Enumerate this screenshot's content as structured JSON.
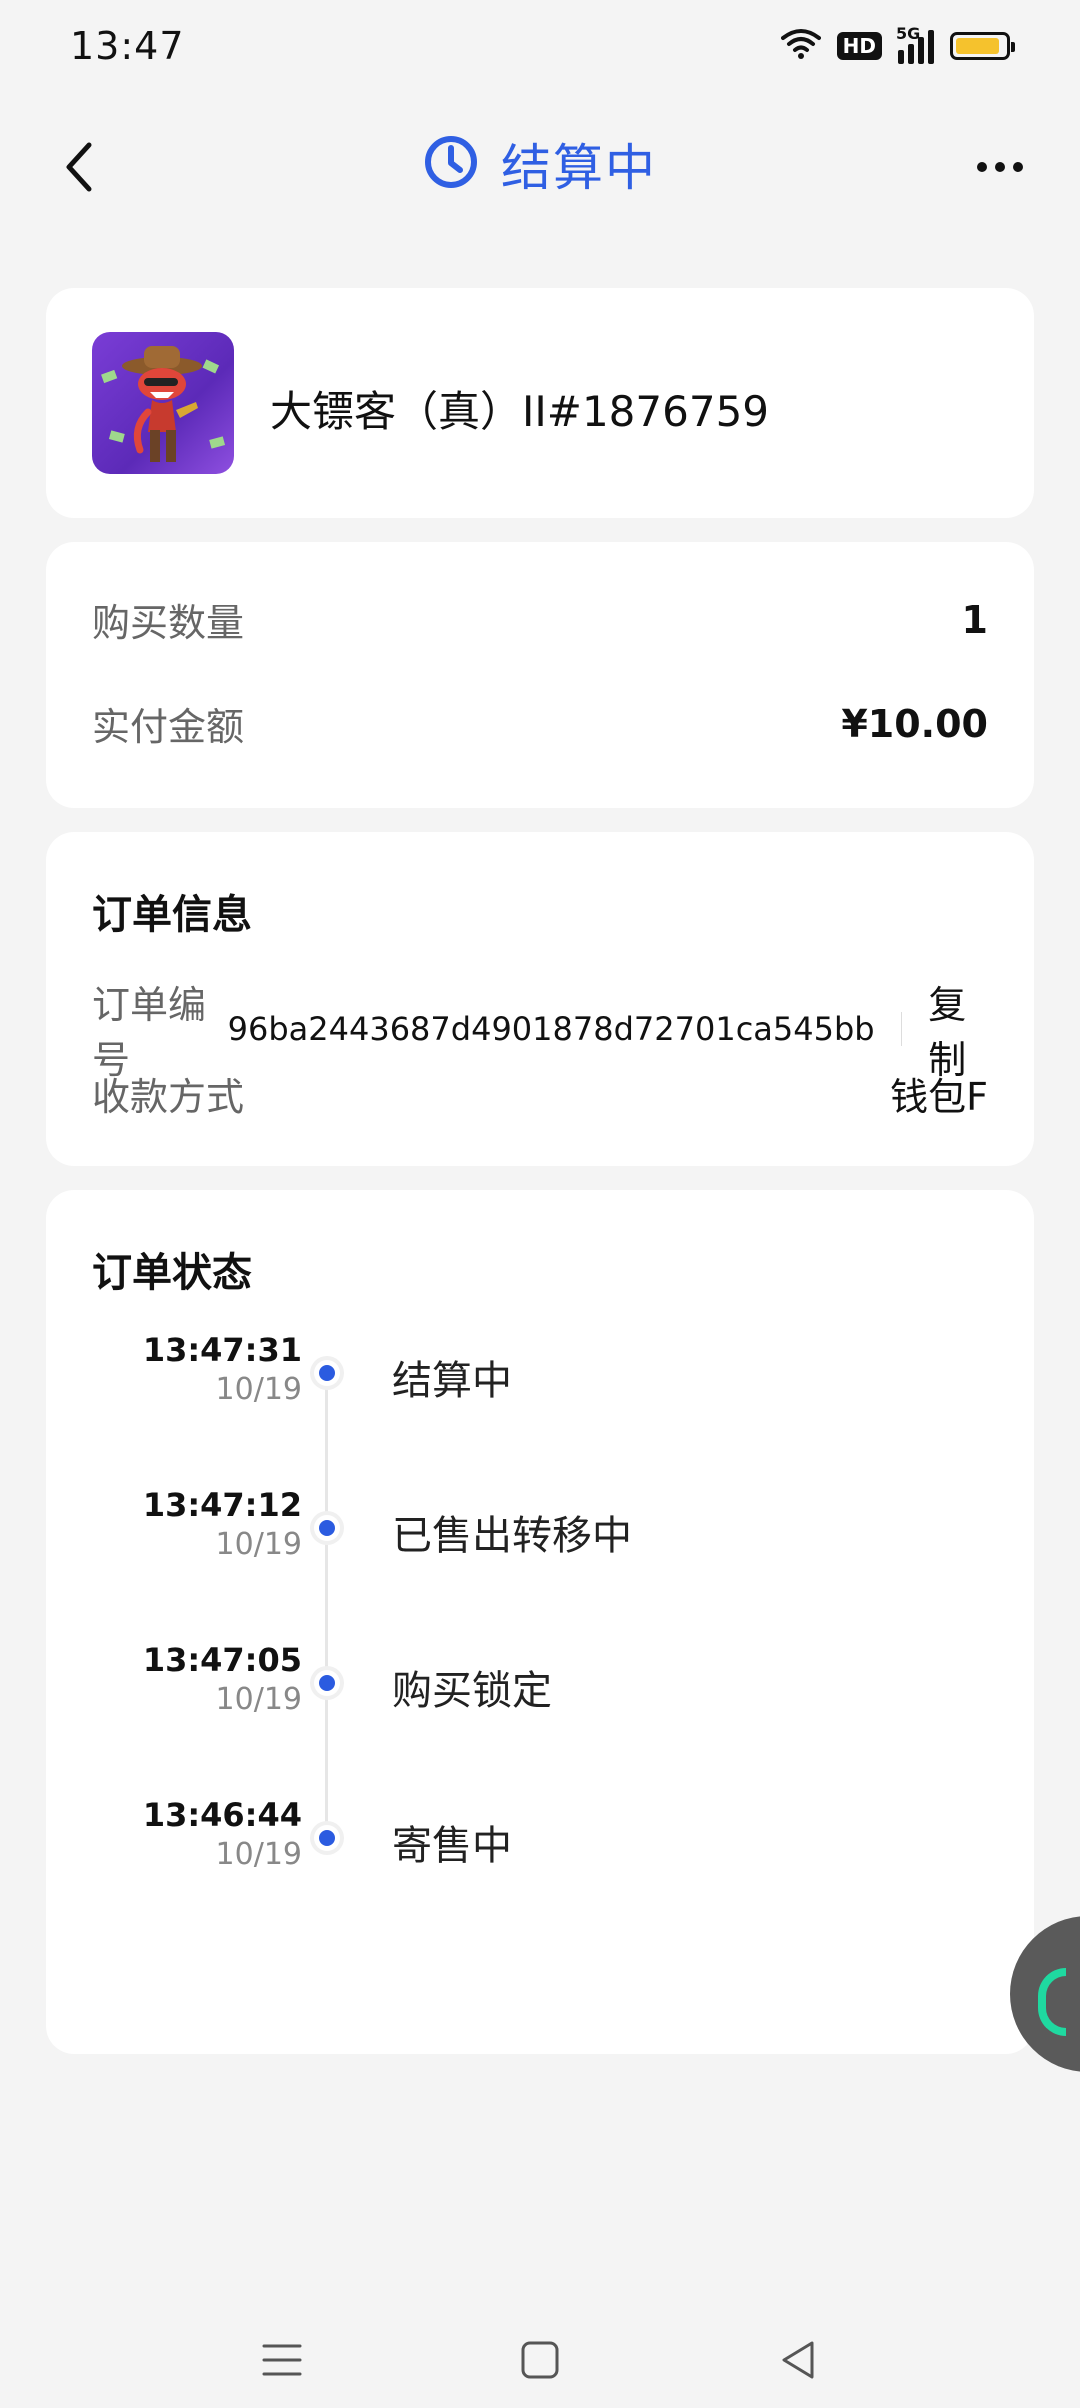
{
  "status_bar": {
    "time": "13:47",
    "hd_label": "HD",
    "network_label": "5G",
    "battery_level": 0.9,
    "battery_color": "#f5c22d"
  },
  "header": {
    "title": "结算中",
    "accent_color": "#2f5fe3"
  },
  "product": {
    "name": "大镖客（真）II#1876759"
  },
  "summary": {
    "quantity_label": "购买数量",
    "quantity_value": "1",
    "amount_label": "实付金额",
    "amount_value": "¥10.00"
  },
  "order_info": {
    "title": "订单信息",
    "order_no_label": "订单编号",
    "order_no_value": "96ba2443687d4901878d72701ca545bb",
    "copy_label": "复制",
    "payment_label": "收款方式",
    "payment_value": "钱包F"
  },
  "order_status": {
    "title": "订单状态",
    "items": [
      {
        "time": "13:47:31",
        "date": "10/19",
        "label": "结算中"
      },
      {
        "time": "13:47:12",
        "date": "10/19",
        "label": "已售出转移中"
      },
      {
        "time": "13:47:05",
        "date": "10/19",
        "label": "购买锁定"
      },
      {
        "time": "13:46:44",
        "date": "10/19",
        "label": "寄售中"
      }
    ]
  }
}
